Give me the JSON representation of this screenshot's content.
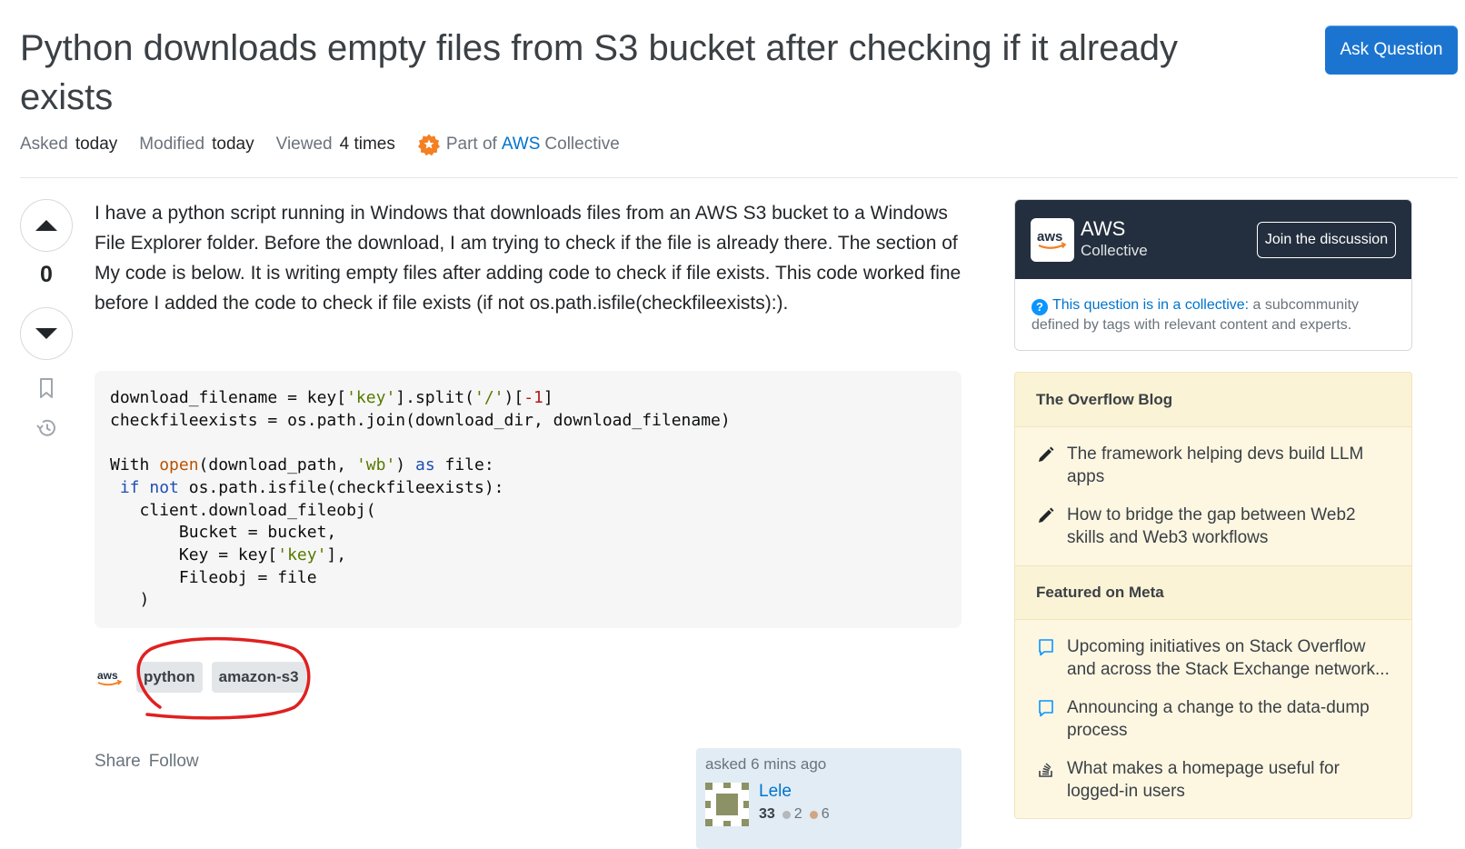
{
  "question": {
    "title": "Python downloads empty files from S3 bucket after checking if it already exists",
    "meta": {
      "asked_label": "Asked",
      "asked_value": "today",
      "modified_label": "Modified",
      "modified_value": "today",
      "viewed_label": "Viewed",
      "viewed_value": "4 times",
      "part_of": "Part of",
      "collective_link": "AWS",
      "collective_word": "Collective"
    },
    "votes": "0",
    "body": "I have a python script running in Windows that downloads files from an AWS S3 bucket to a Windows File Explorer folder. Before the download, I am trying to check if the file is already there. The section of My code is below. It is writing empty files after adding code to check if file exists. This code worked fine before I added the code to check if file exists (if not os.path.isfile(checkfileexists):).",
    "tags": [
      "python",
      "amazon-s3"
    ],
    "share_label": "Share",
    "follow_label": "Follow",
    "owner": {
      "asked": "asked 6 mins ago",
      "name": "Lele",
      "reputation": "33",
      "silver": "2",
      "bronze": "6"
    }
  },
  "header": {
    "ask_button": "Ask Question"
  },
  "sidebar": {
    "collective": {
      "logo_text": "aws",
      "name": "AWS",
      "subtitle": "Collective",
      "join_button": "Join the discussion",
      "desc_link": "This question is in a collective:",
      "desc_rest": " a subcommunity defined by tags with relevant content and experts."
    },
    "blog": {
      "title": "The Overflow Blog",
      "items": [
        "The framework helping devs build LLM apps",
        "How to bridge the gap between Web2 skills and Web3 workflows"
      ]
    },
    "meta": {
      "title": "Featured on Meta",
      "items": [
        "Upcoming initiatives on Stack Overflow and across the Stack Exchange network...",
        "Announcing a change to the data-dump process",
        "What makes a homepage useful for logged-in users"
      ]
    }
  },
  "colors": {
    "accent": "#1b75d0",
    "link": "#0074cc",
    "aws_dark": "#232f3e",
    "annotation": "#e02020"
  }
}
